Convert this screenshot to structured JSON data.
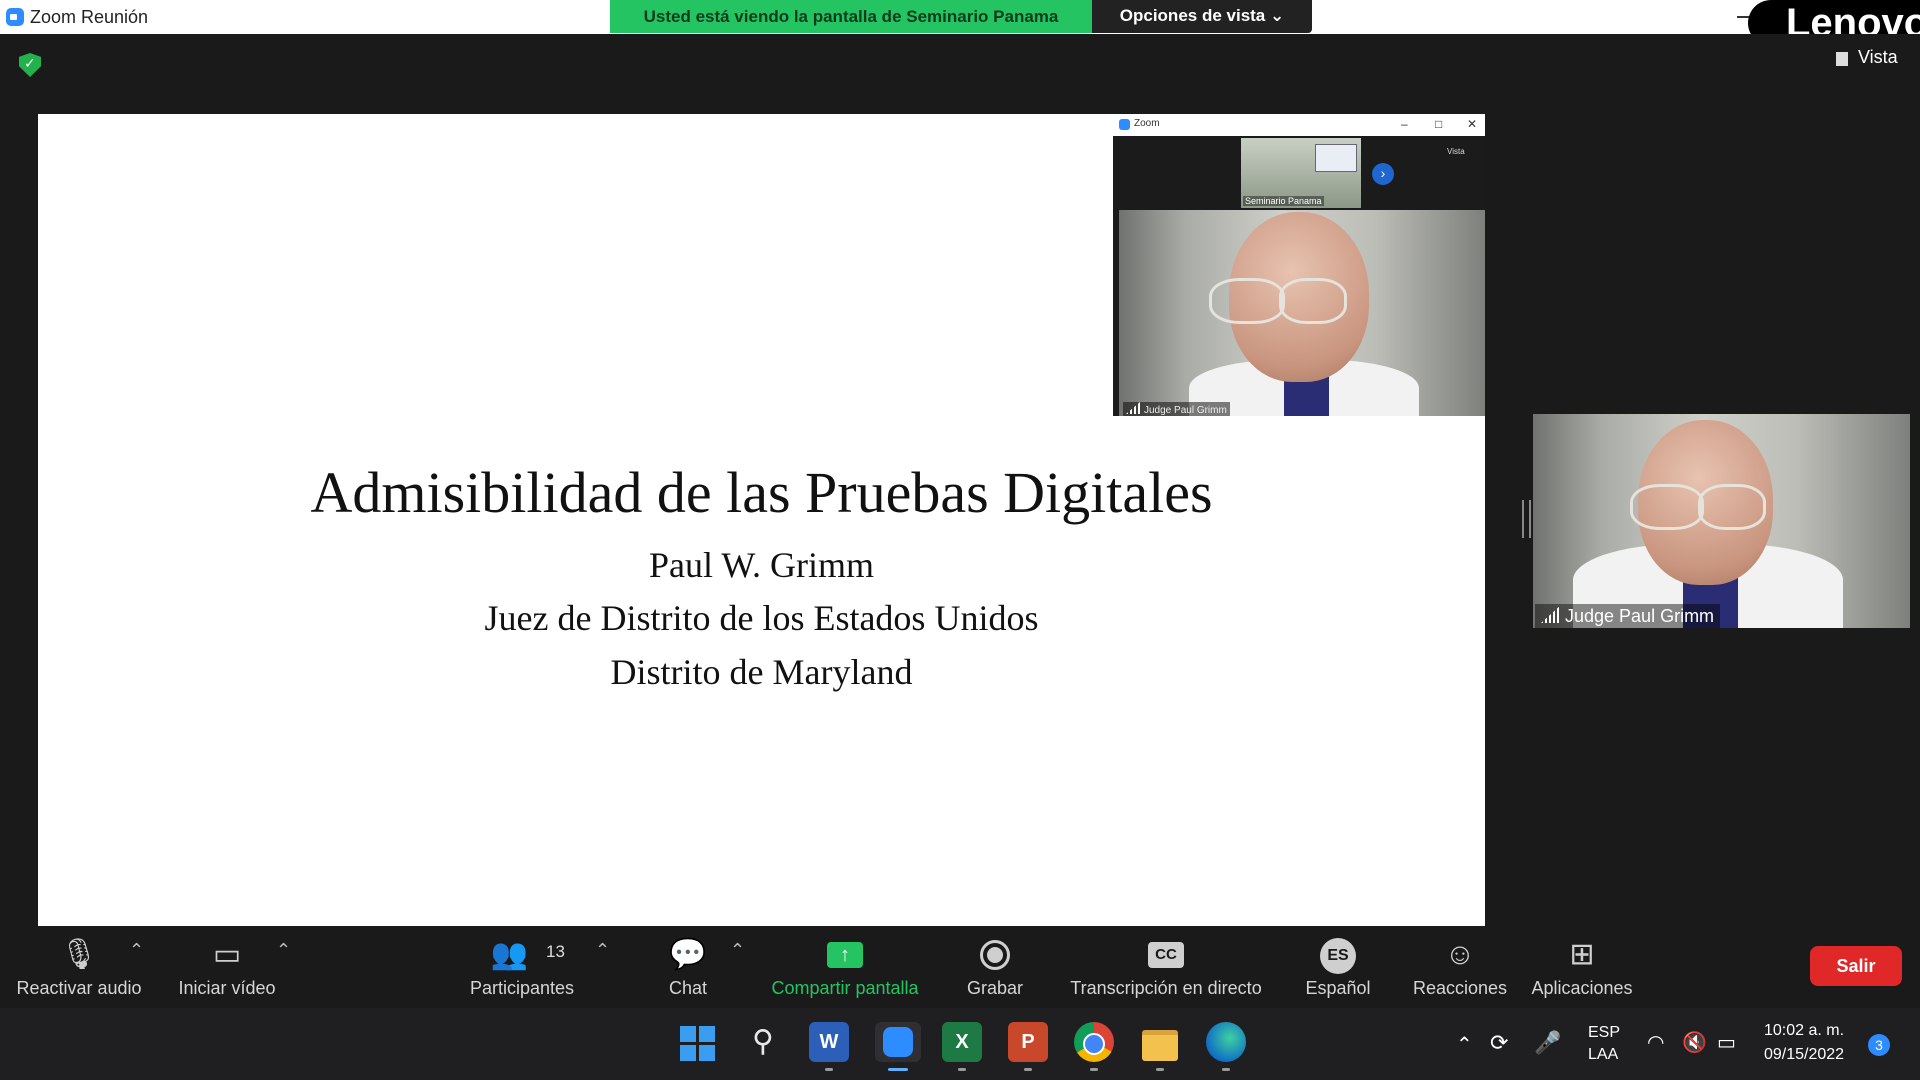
{
  "window": {
    "title": "Zoom Reunión",
    "share_banner": "Usted está viendo la pantalla de Seminario Panama",
    "view_options": "Opciones de vista ⌄",
    "vista": "Vista"
  },
  "branding": {
    "overlay_text": "Lenovo"
  },
  "slide": {
    "title": "Admisibilidad de las Pruebas Digitales",
    "lines": [
      "Paul W. Grimm",
      "Juez de Distrito de los Estados Unidos",
      "Distrito de Maryland"
    ]
  },
  "inner_window": {
    "title": "Zoom",
    "thumb_label": "Seminario Panama",
    "vista": "Vista",
    "video_label": "Judge Paul Grimm"
  },
  "participant_tile": {
    "name": "Judge Paul Grimm"
  },
  "toolbar": {
    "items": [
      {
        "label": "Reactivar audio",
        "icon": "mic-muted-icon"
      },
      {
        "label": "Iniciar vídeo",
        "icon": "video-off-icon"
      },
      {
        "label": "Participantes",
        "icon": "participants-icon",
        "count": "13"
      },
      {
        "label": "Chat",
        "icon": "chat-icon"
      },
      {
        "label": "Compartir pantalla",
        "icon": "share-screen-icon"
      },
      {
        "label": "Grabar",
        "icon": "record-icon"
      },
      {
        "label": "Transcripción en directo",
        "icon": "cc-icon",
        "icon_text": "CC"
      },
      {
        "label": "Español",
        "icon": "language-icon",
        "icon_text": "ES"
      },
      {
        "label": "Reacciones",
        "icon": "reactions-icon"
      },
      {
        "label": "Aplicaciones",
        "icon": "apps-icon"
      }
    ],
    "leave": "Salir",
    "share_color": "#24c463",
    "leave_color": "#e02828"
  },
  "taskbar": {
    "apps": [
      {
        "name": "start",
        "icon": "windows-start-icon"
      },
      {
        "name": "search",
        "icon": "search-icon"
      },
      {
        "name": "word",
        "icon": "word-icon",
        "text": "W"
      },
      {
        "name": "zoom",
        "icon": "zoom-icon"
      },
      {
        "name": "excel",
        "icon": "excel-icon",
        "text": "X"
      },
      {
        "name": "powerpoint",
        "icon": "powerpoint-icon",
        "text": "P"
      },
      {
        "name": "chrome",
        "icon": "chrome-icon"
      },
      {
        "name": "explorer",
        "icon": "file-explorer-icon"
      },
      {
        "name": "edge",
        "icon": "edge-icon"
      }
    ],
    "lang_top": "ESP",
    "lang_bottom": "LAA",
    "time": "10:02 a. m.",
    "date": "09/15/2022",
    "notifications": "3"
  }
}
